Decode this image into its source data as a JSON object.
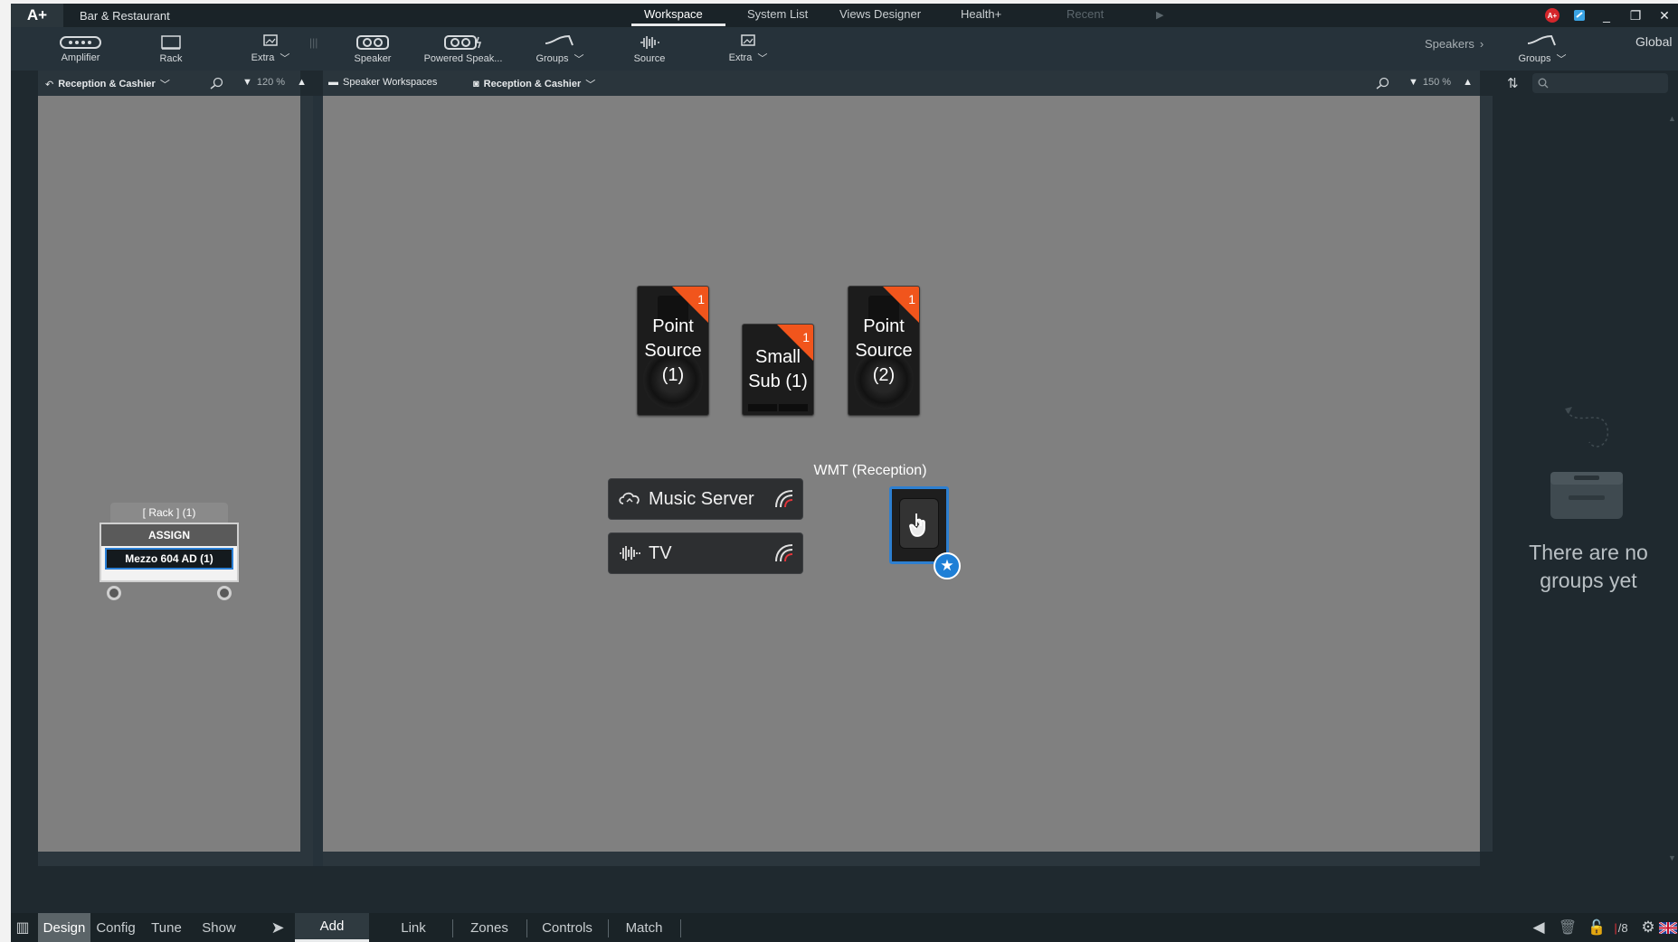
{
  "app": {
    "logo": "A+",
    "title": "Bar & Restaurant"
  },
  "top_tabs": [
    {
      "label": "Workspace",
      "active": true
    },
    {
      "label": "System List",
      "active": false
    },
    {
      "label": "Views Designer",
      "active": false
    },
    {
      "label": "Health+",
      "active": false
    },
    {
      "label": "Recent",
      "active": false
    }
  ],
  "toolbar": {
    "left_tools": [
      {
        "label": "Amplifier",
        "icon": "amplifier-icon"
      },
      {
        "label": "Rack",
        "icon": "rack-icon"
      },
      {
        "label": "Extra",
        "icon": "extra-icon"
      }
    ],
    "main_tools": [
      {
        "label": "Speaker",
        "icon": "speaker-icon"
      },
      {
        "label": "Powered Speak...",
        "icon": "powered-speaker-icon"
      },
      {
        "label": "Groups",
        "icon": "groups-icon"
      },
      {
        "label": "Source",
        "icon": "source-icon"
      },
      {
        "label": "Extra",
        "icon": "extra-icon"
      }
    ],
    "speakers_link": "Speakers",
    "right_tool": {
      "label": "Groups",
      "icon": "groups-icon"
    },
    "global_label": "Global"
  },
  "left_panel": {
    "view_selector": "Reception & Cashier",
    "zoom": "120 %",
    "rack": {
      "title": "[ Rack ] (1)",
      "assign_label": "ASSIGN",
      "device_label": "Mezzo 604 AD (1)"
    }
  },
  "main_panel": {
    "breadcrumb_root": "Speaker Workspaces",
    "view_selector": "Reception & Cashier",
    "zoom": "150 %",
    "speakers": [
      {
        "line1": "Point",
        "line2": "Source",
        "line3": "(1)",
        "badge": "1"
      },
      {
        "line1": "Small",
        "line2": "Sub (1)",
        "badge": "1"
      },
      {
        "line1": "Point",
        "line2": "Source",
        "line3": "(2)",
        "badge": "1"
      }
    ],
    "sources": [
      {
        "label": "Music Server",
        "icon": "cloud-icon"
      },
      {
        "label": "TV",
        "icon": "waveform-icon"
      }
    ],
    "wmt": {
      "label": "WMT (Reception)"
    }
  },
  "right_panel": {
    "search_placeholder": "",
    "empty_line1": "There are no",
    "empty_line2": "groups yet"
  },
  "bottom": {
    "modes": [
      {
        "label": "Design",
        "active": true
      },
      {
        "label": "Config",
        "active": false
      },
      {
        "label": "Tune",
        "active": false
      },
      {
        "label": "Show",
        "active": false
      }
    ],
    "actions": [
      {
        "label": "Add",
        "active": true
      },
      {
        "label": "Link",
        "active": false
      },
      {
        "label": "Zones",
        "active": false
      },
      {
        "label": "Controls",
        "active": false
      },
      {
        "label": "Match",
        "active": false
      }
    ],
    "counter": "/8"
  },
  "colors": {
    "accent_orange": "#f1551c",
    "canvas_gray": "#808080",
    "panel_dark": "#1f292f",
    "selection_blue": "#1e7fd6"
  }
}
